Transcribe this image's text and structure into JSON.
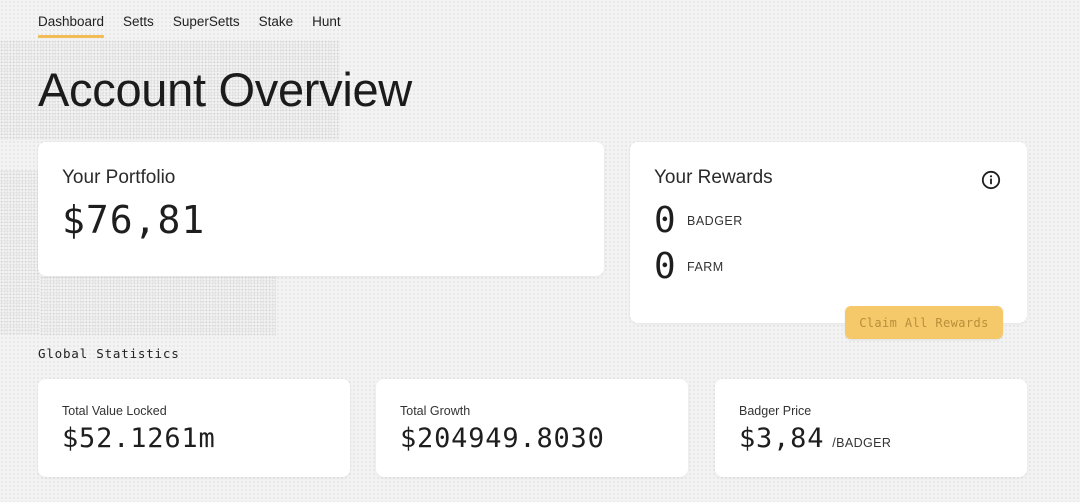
{
  "nav": {
    "items": [
      {
        "label": "Dashboard",
        "active": true
      },
      {
        "label": "Setts",
        "active": false
      },
      {
        "label": "SuperSetts",
        "active": false
      },
      {
        "label": "Stake",
        "active": false
      },
      {
        "label": "Hunt",
        "active": false
      }
    ]
  },
  "page_title": "Account Overview",
  "portfolio": {
    "title": "Your Portfolio",
    "value": "$76,81"
  },
  "rewards": {
    "title": "Your Rewards",
    "info_icon": "info-icon",
    "items": [
      {
        "amount": "0",
        "token": "BADGER"
      },
      {
        "amount": "0",
        "token": "FARM"
      }
    ],
    "claim_label": "Claim All Rewards"
  },
  "global_stats": {
    "label": "Global Statistics",
    "cards": [
      {
        "label": "Total Value Locked",
        "value": "$52.1261m",
        "unit": ""
      },
      {
        "label": "Total Growth",
        "value": "$204949.8030",
        "unit": ""
      },
      {
        "label": "Badger Price",
        "value": "$3,84",
        "unit": "/BADGER"
      }
    ]
  },
  "colors": {
    "accent": "#f2bc57",
    "claim_button": "#f5c86a",
    "background": "#f3f3f3",
    "card": "#ffffff"
  }
}
